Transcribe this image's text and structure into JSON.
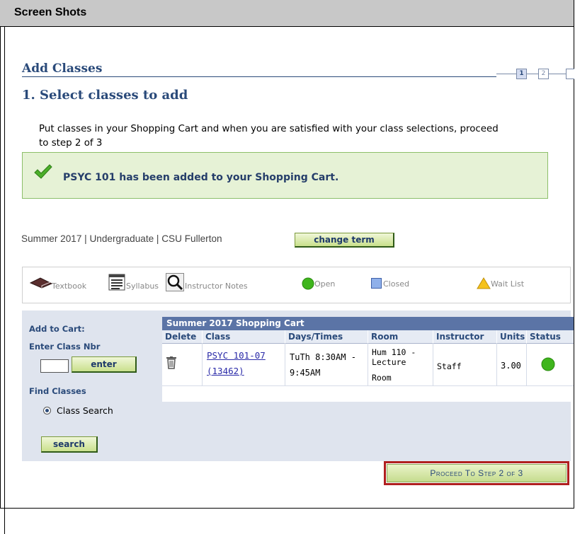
{
  "document": {
    "section_title": "Screen Shots"
  },
  "page": {
    "heading": "Add Classes",
    "steps": [
      "1",
      "2"
    ],
    "step_title": "1.  Select classes to add",
    "instructions": "Put classes in your Shopping Cart and when you are satisfied with your class selections, proceed to step 2 of 3"
  },
  "message": {
    "icon": "checkmark-icon",
    "text": "PSYC  101 has been added to your Shopping Cart.",
    "accent": "#4caf2a"
  },
  "term": {
    "text": "Summer 2017 | Undergraduate | CSU Fullerton",
    "change_button": "change term"
  },
  "legend": {
    "items": [
      {
        "label": "Textbook",
        "icon": "textbook-icon"
      },
      {
        "label": "Syllabus",
        "icon": "syllabus-icon"
      },
      {
        "label": "Instructor Notes",
        "icon": "magnifier-icon"
      },
      {
        "label": "Open",
        "icon": "green-circle-icon",
        "color": "#3fb51d"
      },
      {
        "label": "Closed",
        "icon": "blue-square-icon",
        "color": "#6c8fd8"
      },
      {
        "label": "Wait List",
        "icon": "yellow-triangle-icon",
        "color": "#f5c21a"
      }
    ]
  },
  "add_panel": {
    "add_to_cart": "Add to Cart:",
    "enter_class_nbr": "Enter Class Nbr",
    "class_nbr_value": "",
    "enter_button": "enter",
    "find_classes": "Find Classes",
    "radio_label": "Class Search",
    "search_button": "search"
  },
  "cart": {
    "title": "Summer 2017 Shopping Cart",
    "columns": [
      "Delete",
      "Class",
      "Days/Times",
      "Room",
      "Instructor",
      "Units",
      "Status"
    ],
    "rows": [
      {
        "class_code": "PSYC 101-07",
        "class_nbr": "(13462)",
        "days_line1": "TuTh 8:30AM -",
        "days_line2": "9:45AM",
        "room_line1": "Hum 110 -",
        "room_line2": "Lecture",
        "room_line3": "Room",
        "instructor": "Staff",
        "units": "3.00",
        "status": "Open"
      }
    ]
  },
  "proceed_button": "Proceed To Step 2 of 3"
}
